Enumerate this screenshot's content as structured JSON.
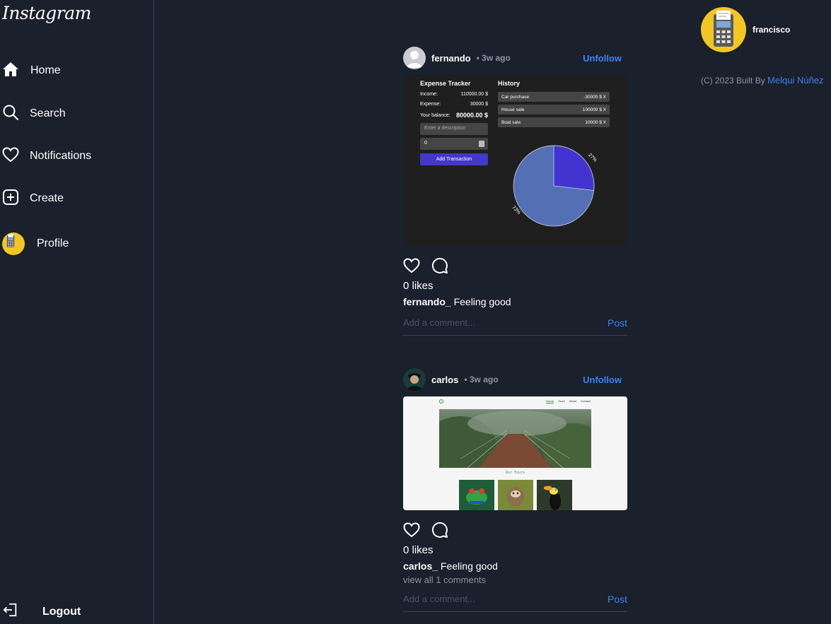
{
  "app": {
    "logo": "Instagram"
  },
  "sidebar": {
    "items": [
      {
        "label": "Home",
        "icon": "home-icon"
      },
      {
        "label": "Search",
        "icon": "search-icon"
      },
      {
        "label": "Notifications",
        "icon": "heart-icon"
      },
      {
        "label": "Create",
        "icon": "plus-square-icon"
      },
      {
        "label": "Profile",
        "icon": "avatar"
      }
    ],
    "logout": "Logout"
  },
  "posts": [
    {
      "username": "fernando",
      "time": "• 3w ago",
      "follow_label": "Unfollow",
      "likes": "0 likes",
      "caption_user": "fernando_",
      "caption_text": " Feeling good",
      "comment_placeholder": "Add a comment...",
      "post_label": "Post",
      "image": {
        "title": "Expense Tracker",
        "rows": [
          {
            "label": "Income:",
            "value": "110000.00 $"
          },
          {
            "label": "Expense:",
            "value": "30000 $"
          },
          {
            "label": "Your balance:",
            "value": "80000.00 $"
          }
        ],
        "description_placeholder": "Enter a description",
        "amount_value": "0",
        "add_button": "Add Transaction",
        "history_title": "History",
        "history": [
          {
            "label": "Car purchase",
            "value": "-30000 $ X"
          },
          {
            "label": "House sale",
            "value": "100000 $ X"
          },
          {
            "label": "Boat sale",
            "value": "10000 $ X"
          }
        ],
        "pie_labels": [
          "27%",
          "73%"
        ]
      }
    },
    {
      "username": "carlos",
      "time": "• 3w ago",
      "follow_label": "Unfollow",
      "likes": "0 likes",
      "caption_user": "carlos_",
      "caption_text": " Feeling good",
      "view_comments": "view all 1 comments",
      "comment_placeholder": "Add a comment...",
      "post_label": "Post",
      "image": {
        "nav": [
          "Home",
          "Tours",
          "About",
          "Contact"
        ],
        "heading": "Our Tours"
      }
    }
  ],
  "profile": {
    "username": "francisco"
  },
  "footer": {
    "text": "(C) 2023 Built By ",
    "author": "Melqui Núñez"
  },
  "colors": {
    "background": "#1a202c",
    "accent": "#3b82f6",
    "avatar_bg": "#f3c623"
  }
}
